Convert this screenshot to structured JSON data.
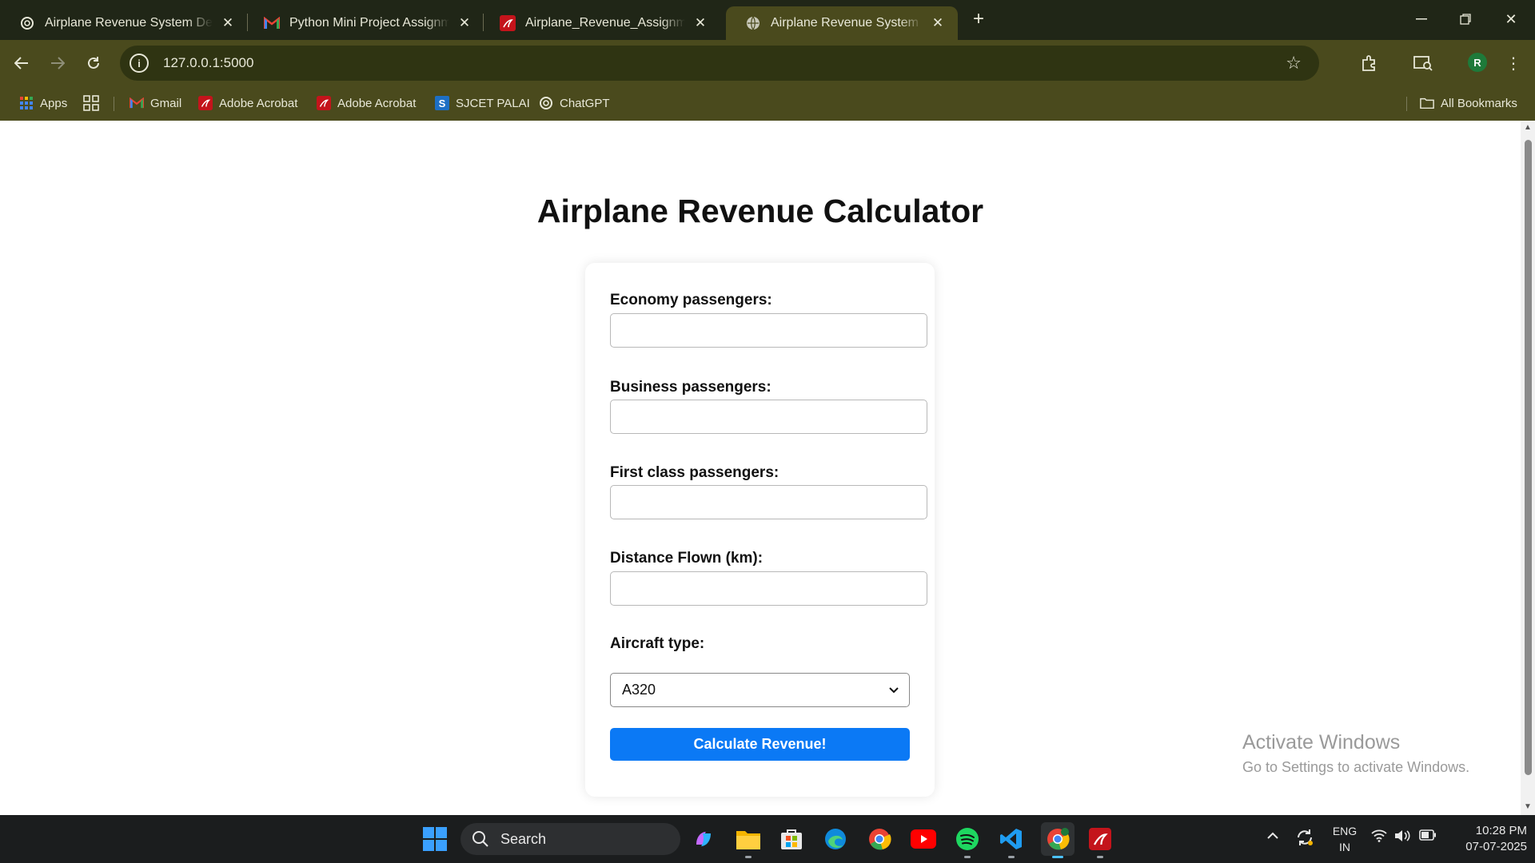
{
  "browser": {
    "tabs": [
      {
        "title": "Airplane Revenue System Devel",
        "icon": "chatgpt-icon"
      },
      {
        "title": "Python Mini Project Assignment",
        "icon": "gmail-icon"
      },
      {
        "title": "Airplane_Revenue_Assignment.p",
        "icon": "acrobat-icon"
      },
      {
        "title": "Airplane Revenue System",
        "icon": "globe-icon"
      }
    ],
    "active_tab": 3,
    "url": "127.0.0.1:5000",
    "avatar_letter": "R",
    "bookmarks": [
      {
        "label": "Apps",
        "icon": "apps-grid-icon"
      },
      {
        "label": "Gmail",
        "icon": "gmail-icon"
      },
      {
        "label": "Adobe Acrobat",
        "icon": "acrobat-icon"
      },
      {
        "label": "Adobe Acrobat",
        "icon": "acrobat-icon"
      },
      {
        "label": "SJCET PALAI",
        "icon": "sjcet-icon"
      },
      {
        "label": "ChatGPT",
        "icon": "chatgpt-icon"
      }
    ],
    "all_bookmarks_label": "All Bookmarks"
  },
  "page": {
    "title": "Airplane Revenue Calculator",
    "fields": [
      {
        "label": "Economy passengers:",
        "value": ""
      },
      {
        "label": "Business passengers:",
        "value": ""
      },
      {
        "label": "First class passengers:",
        "value": ""
      },
      {
        "label": "Distance Flown (km):",
        "value": ""
      }
    ],
    "aircraft": {
      "label": "Aircraft type:",
      "selected": "A320"
    },
    "submit_label": "Calculate Revenue!"
  },
  "watermark": {
    "title": "Activate Windows",
    "subtitle": "Go to Settings to activate Windows."
  },
  "taskbar": {
    "search_label": "Search",
    "lang_line1": "ENG",
    "lang_line2": "IN",
    "time": "10:28 PM",
    "date": "07-07-2025"
  },
  "colors": {
    "chrome": "#4a4a1d",
    "tabstrip": "#202617",
    "accent_button": "#0b79f5",
    "taskbar": "#1b1d1e"
  }
}
